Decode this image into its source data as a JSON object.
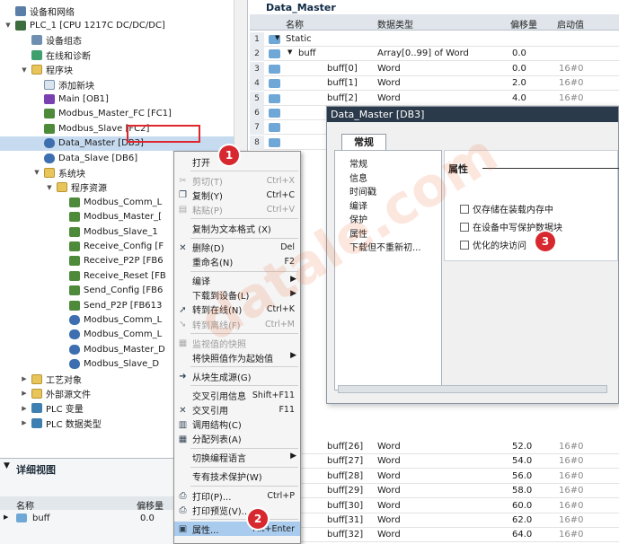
{
  "tree": {
    "items": [
      {
        "label": "设备和网络",
        "icon": "network-icon",
        "indent": 18,
        "toggle": ""
      },
      {
        "label": "PLC_1 [CPU 1217C DC/DC/DC]",
        "icon": "cpu-icon",
        "indent": 18,
        "toggle": "▼"
      },
      {
        "label": "设备组态",
        "icon": "device-config-icon",
        "indent": 36,
        "toggle": ""
      },
      {
        "label": "在线和诊断",
        "icon": "diagnostics-icon",
        "indent": 36,
        "toggle": ""
      },
      {
        "label": "程序块",
        "icon": "folder-icon",
        "indent": 36,
        "toggle": "▼"
      },
      {
        "label": "添加新块",
        "icon": "add-block-icon",
        "indent": 50,
        "toggle": ""
      },
      {
        "label": "Main [OB1]",
        "icon": "ob-icon",
        "indent": 50,
        "toggle": ""
      },
      {
        "label": "Modbus_Master_FC [FC1]",
        "icon": "fc-icon",
        "indent": 50,
        "toggle": ""
      },
      {
        "label": "Modbus_Slave [FC2]",
        "icon": "fc-icon",
        "indent": 50,
        "toggle": ""
      },
      {
        "label": "Data_Master [DB3]",
        "icon": "db-icon",
        "indent": 50,
        "toggle": ""
      },
      {
        "label": "Data_Slave [DB6]",
        "icon": "db-icon",
        "indent": 50,
        "toggle": ""
      },
      {
        "label": "系统块",
        "icon": "folder-icon",
        "indent": 50,
        "toggle": "▼"
      },
      {
        "label": "程序资源",
        "icon": "folder-icon",
        "indent": 64,
        "toggle": "▼"
      },
      {
        "label": "Modbus_Comm_L",
        "icon": "fb-icon",
        "indent": 78,
        "toggle": ""
      },
      {
        "label": "Modbus_Master_[",
        "icon": "fb-icon",
        "indent": 78,
        "toggle": ""
      },
      {
        "label": "Modbus_Slave_1",
        "icon": "fb-icon",
        "indent": 78,
        "toggle": ""
      },
      {
        "label": "Receive_Config [F",
        "icon": "fb-icon",
        "indent": 78,
        "toggle": ""
      },
      {
        "label": "Receive_P2P [FB6",
        "icon": "fb-icon",
        "indent": 78,
        "toggle": ""
      },
      {
        "label": "Receive_Reset [FB",
        "icon": "fb-icon",
        "indent": 78,
        "toggle": ""
      },
      {
        "label": "Send_Config [FB6",
        "icon": "fb-icon",
        "indent": 78,
        "toggle": ""
      },
      {
        "label": "Send_P2P [FB613",
        "icon": "fb-icon",
        "indent": 78,
        "toggle": ""
      },
      {
        "label": "Modbus_Comm_L",
        "icon": "db-icon",
        "indent": 78,
        "toggle": ""
      },
      {
        "label": "Modbus_Comm_L",
        "icon": "db-icon",
        "indent": 78,
        "toggle": ""
      },
      {
        "label": "Modbus_Master_D",
        "icon": "db-icon",
        "indent": 78,
        "toggle": ""
      },
      {
        "label": "Modbus_Slave_D",
        "icon": "db-icon",
        "indent": 78,
        "toggle": ""
      },
      {
        "label": "工艺对象",
        "icon": "folder-icon",
        "indent": 36,
        "toggle": "▶"
      },
      {
        "label": "外部源文件",
        "icon": "folder-icon",
        "indent": 36,
        "toggle": "▶"
      },
      {
        "label": "PLC 变量",
        "icon": "plc-tags-icon",
        "indent": 36,
        "toggle": "▶"
      },
      {
        "label": "PLC 数据类型",
        "icon": "plc-types-icon",
        "indent": 36,
        "toggle": "▶"
      }
    ]
  },
  "detail": {
    "title": "详细视图",
    "col_name": "名称",
    "col_offset": "偏移量",
    "row_name": "buff",
    "row_offset": "0.0"
  },
  "editor": {
    "title": "Data_Master",
    "headers": {
      "name": "名称",
      "type": "数据类型",
      "offset": "偏移量",
      "start": "启动值"
    },
    "rows": [
      {
        "n": "1",
        "name": "Static",
        "type": "",
        "offset": "",
        "start": "",
        "toggle": "▼"
      },
      {
        "n": "2",
        "name": "buff",
        "type": "Array[0..99] of Word",
        "offset": "0.0",
        "start": "",
        "toggle": "▼"
      },
      {
        "n": "3",
        "name": "buff[0]",
        "type": "Word",
        "offset": "0.0",
        "start": "16#0",
        "toggle": ""
      },
      {
        "n": "4",
        "name": "buff[1]",
        "type": "Word",
        "offset": "2.0",
        "start": "16#0",
        "toggle": ""
      },
      {
        "n": "5",
        "name": "buff[2]",
        "type": "Word",
        "offset": "4.0",
        "start": "16#0",
        "toggle": ""
      },
      {
        "n": "6",
        "name": "",
        "type": "",
        "offset": "",
        "start": "",
        "toggle": ""
      },
      {
        "n": "7",
        "name": "",
        "type": "",
        "offset": "",
        "start": "",
        "toggle": ""
      },
      {
        "n": "8",
        "name": "",
        "type": "",
        "offset": "",
        "start": "",
        "toggle": ""
      }
    ],
    "bottom_rows": [
      {
        "n": "",
        "name": "buff[26]",
        "type": "Word",
        "offset": "52.0",
        "start": "16#0"
      },
      {
        "n": "",
        "name": "buff[27]",
        "type": "Word",
        "offset": "54.0",
        "start": "16#0"
      },
      {
        "n": "",
        "name": "buff[28]",
        "type": "Word",
        "offset": "56.0",
        "start": "16#0"
      },
      {
        "n": "",
        "name": "buff[29]",
        "type": "Word",
        "offset": "58.0",
        "start": "16#0"
      },
      {
        "n": "",
        "name": "buff[30]",
        "type": "Word",
        "offset": "60.0",
        "start": "16#0"
      },
      {
        "n": "",
        "name": "buff[31]",
        "type": "Word",
        "offset": "62.0",
        "start": "16#0"
      },
      {
        "n": "",
        "name": "buff[32]",
        "type": "Word",
        "offset": "64.0",
        "start": "16#0"
      }
    ]
  },
  "dialog": {
    "title": "Data_Master [DB3]",
    "tab": "常规",
    "nav": [
      "常规",
      "信息",
      "时间戳",
      "编译",
      "保护",
      "属性",
      "下载但不重新初..."
    ],
    "panel_title": "属性",
    "options": [
      {
        "label": "仅存储在装载内存中",
        "checked": false
      },
      {
        "label": "在设备中写保护数据块",
        "checked": false
      },
      {
        "label": "优化的块访问",
        "checked": false
      }
    ]
  },
  "menu": {
    "items": [
      {
        "label": "打开",
        "shortcut": "",
        "icon": "",
        "disabled": false,
        "arrow": false
      },
      {
        "sep": true
      },
      {
        "label": "剪切(T)",
        "shortcut": "Ctrl+X",
        "icon": "cut-icon",
        "disabled": true,
        "arrow": false
      },
      {
        "label": "复制(Y)",
        "shortcut": "Ctrl+C",
        "icon": "copy-icon",
        "disabled": false,
        "arrow": false
      },
      {
        "label": "粘贴(P)",
        "shortcut": "Ctrl+V",
        "icon": "paste-icon",
        "disabled": true,
        "arrow": false
      },
      {
        "sep": true
      },
      {
        "label": "复制为文本格式 (X)",
        "shortcut": "",
        "icon": "",
        "disabled": false,
        "arrow": false
      },
      {
        "sep": true
      },
      {
        "label": "删除(D)",
        "shortcut": "Del",
        "icon": "delete-icon",
        "disabled": false,
        "arrow": false
      },
      {
        "label": "重命名(N)",
        "shortcut": "F2",
        "icon": "",
        "disabled": false,
        "arrow": false
      },
      {
        "sep": true
      },
      {
        "label": "编译",
        "shortcut": "",
        "icon": "",
        "disabled": false,
        "arrow": true
      },
      {
        "label": "下载到设备(L)",
        "shortcut": "",
        "icon": "",
        "disabled": false,
        "arrow": true
      },
      {
        "label": "转到在线(N)",
        "shortcut": "Ctrl+K",
        "icon": "go-online-icon",
        "disabled": false,
        "arrow": false
      },
      {
        "label": "转到离线(F)",
        "shortcut": "Ctrl+M",
        "icon": "go-offline-icon",
        "disabled": true,
        "arrow": false
      },
      {
        "sep": true
      },
      {
        "label": "监视值的快照",
        "shortcut": "",
        "icon": "snapshot-icon",
        "disabled": true,
        "arrow": false
      },
      {
        "label": "将快照值作为起始值",
        "shortcut": "",
        "icon": "",
        "disabled": false,
        "arrow": true
      },
      {
        "sep": true
      },
      {
        "label": "从块生成源(G)",
        "shortcut": "",
        "icon": "generate-source-icon",
        "disabled": false,
        "arrow": false
      },
      {
        "sep": true
      },
      {
        "label": "交叉引用信息",
        "shortcut": "Shift+F11",
        "icon": "",
        "disabled": false,
        "arrow": false
      },
      {
        "label": "交叉引用",
        "shortcut": "F11",
        "icon": "cross-ref-icon",
        "disabled": false,
        "arrow": false
      },
      {
        "label": "调用结构(C)",
        "shortcut": "",
        "icon": "call-structure-icon",
        "disabled": false,
        "arrow": false
      },
      {
        "label": "分配列表(A)",
        "shortcut": "",
        "icon": "assignment-list-icon",
        "disabled": false,
        "arrow": false
      },
      {
        "sep": true
      },
      {
        "label": "切换编程语言",
        "shortcut": "",
        "icon": "",
        "disabled": false,
        "arrow": true
      },
      {
        "sep": true
      },
      {
        "label": "专有技术保护(W)",
        "shortcut": "",
        "icon": "",
        "disabled": false,
        "arrow": false
      },
      {
        "sep": true
      },
      {
        "label": "打印(P)...",
        "shortcut": "Ctrl+P",
        "icon": "print-icon",
        "disabled": false,
        "arrow": false
      },
      {
        "label": "打印预览(V)...",
        "shortcut": "",
        "icon": "print-preview-icon",
        "disabled": false,
        "arrow": false
      },
      {
        "sep": true
      },
      {
        "label": "属性...",
        "shortcut": "Alt+Enter",
        "icon": "properties-icon",
        "disabled": false,
        "arrow": false,
        "hover": true
      }
    ]
  },
  "badges": [
    "1",
    "2",
    "3"
  ],
  "watermark": "datale.com"
}
